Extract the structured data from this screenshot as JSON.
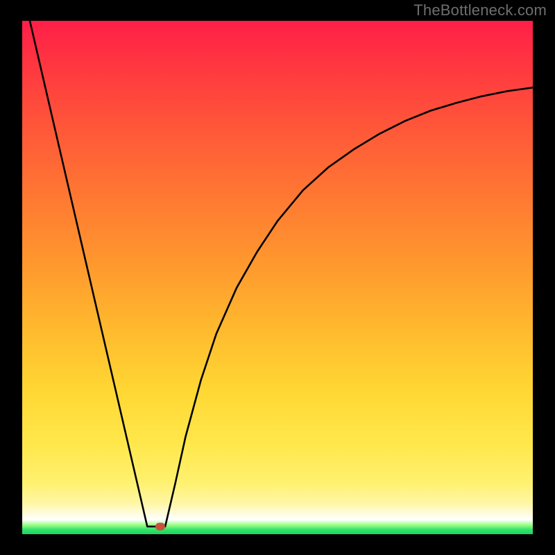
{
  "watermark": "TheBottleneck.com",
  "chart_data": {
    "type": "line",
    "title": "",
    "xlabel": "",
    "ylabel": "",
    "xlim": [
      0,
      100
    ],
    "ylim": [
      0,
      100
    ],
    "grid": false,
    "legend": false,
    "background": "red-yellow-green vertical gradient",
    "series": [
      {
        "name": "left-slope",
        "x": [
          1.5,
          24.5
        ],
        "y": [
          100,
          1.5
        ]
      },
      {
        "name": "valley-floor",
        "x": [
          24.5,
          28.0
        ],
        "y": [
          1.5,
          1.5
        ]
      },
      {
        "name": "right-rise",
        "x": [
          28.0,
          30,
          32,
          35,
          38,
          42,
          46,
          50,
          55,
          60,
          65,
          70,
          75,
          80,
          85,
          90,
          95,
          100
        ],
        "y": [
          1.5,
          10,
          19,
          30,
          39,
          48,
          55,
          61,
          67,
          71.5,
          75,
          78,
          80.5,
          82.5,
          84,
          85.3,
          86.3,
          87
        ]
      }
    ],
    "marker": {
      "x": 27,
      "y": 1.5,
      "color": "#c9503d"
    }
  },
  "colors": {
    "frame": "#000000",
    "curve": "#000000",
    "watermark": "#6e6e6e",
    "marker": "#c9503d"
  }
}
